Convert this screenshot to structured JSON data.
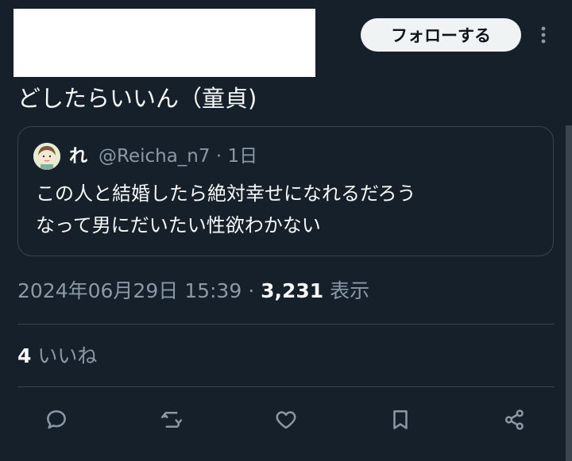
{
  "header": {
    "follow_label": "フォローする"
  },
  "tweet": {
    "text": "どしたらいいん（童貞)"
  },
  "quote": {
    "name": "れ",
    "handle": "@Reicha_n7",
    "separator": "·",
    "age": "1日",
    "lines": [
      "この人と結婚したら絶対幸せになれるだろう",
      "なって男にだいたい性欲わかない"
    ]
  },
  "meta": {
    "timestamp": "2024年06月29日 15:39",
    "separator": "·",
    "views_count": "3,231",
    "views_label": "表示"
  },
  "likes": {
    "count": "4",
    "label": "いいね"
  },
  "icons": {
    "more": "more-vertical-icon",
    "reply": "reply-icon",
    "retweet": "retweet-icon",
    "like": "heart-icon",
    "bookmark": "bookmark-icon",
    "share": "share-icon"
  },
  "colors": {
    "background": "#15202b",
    "text": "#f7f9f9",
    "secondary_text": "#8b98a5",
    "border": "#38444d",
    "follow_button_bg": "#eff3f4"
  }
}
